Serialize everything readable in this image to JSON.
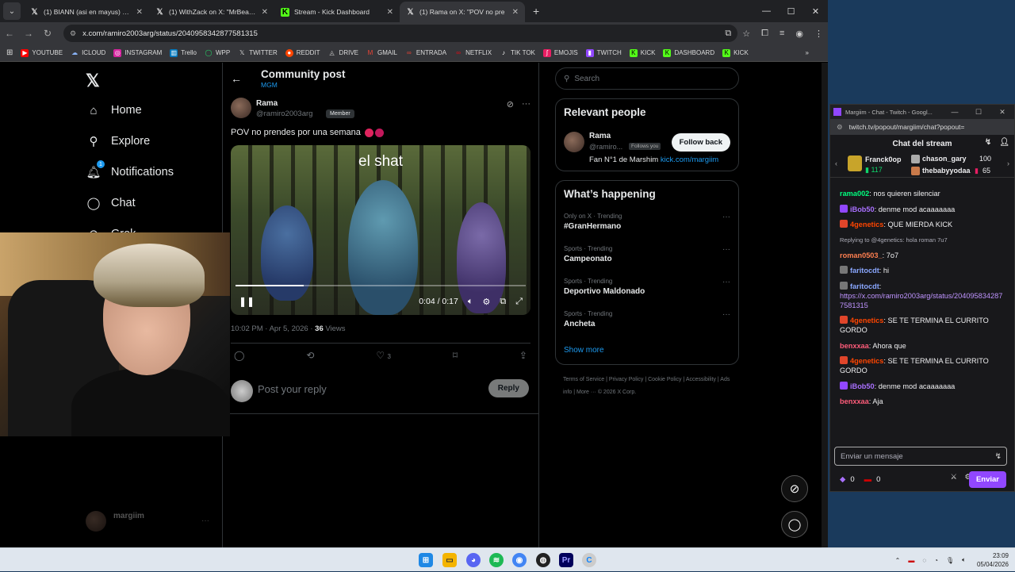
{
  "browser": {
    "tabs": [
      {
        "title": "(1) BIANN (asi en mayus) on X:",
        "icon": "x-icon"
      },
      {
        "title": "(1) WithZack on X: \"MrBeast ha",
        "icon": "x-icon"
      },
      {
        "title": "Stream - Kick Dashboard",
        "icon": "kick-icon"
      },
      {
        "title": "(1) Rama on X: \"POV no pre",
        "icon": "x-icon"
      }
    ],
    "url": "x.com/ramiro2003arg/status/2040958342877581315",
    "bookmarks": [
      "YOUTUBE",
      "ICLOUD",
      "INSTAGRAM",
      "Trello",
      "WPP",
      "TWITTER",
      "REDDIT",
      "DRIVE",
      "GMAIL",
      "ENTRADA",
      "NETFLIX",
      "TIK TOK",
      "EMOJIS",
      "TWITCH",
      "KICK",
      "DASHBOARD",
      "KICK"
    ]
  },
  "x": {
    "nav": {
      "home": "Home",
      "explore": "Explore",
      "notifications": "Notifications",
      "notif_count": "1",
      "chat": "Chat",
      "grok": "Grok"
    },
    "header": {
      "title": "Community post",
      "community": "MGM"
    },
    "post": {
      "name": "Rama",
      "handle": "@ramiro2003arg",
      "member_badge": "Member",
      "text": "POV no prendes por una semana",
      "video_caption": "el shat",
      "video_time": "0:04 / 0:17",
      "video_progress": 0.235,
      "meta_time": "10:02 PM · Apr 5, 2026 · ",
      "views_count": "36",
      "views_label": " Views",
      "likes": "3"
    },
    "reply": {
      "placeholder": "Post your reply",
      "button": "Reply"
    },
    "search_placeholder": "Search",
    "relevant": {
      "title": "Relevant people",
      "name": "Rama",
      "handle": "@ramiro...",
      "follows_you": "Follows you",
      "follow_button": "Follow back",
      "bio": "Fan N°1 de Marshim ",
      "bio_link": "kick.com/margiim"
    },
    "happening": {
      "title": "What’s happening",
      "trends": [
        {
          "context": "Only on X · Trending",
          "name": "#GranHermano"
        },
        {
          "context": "Sports · Trending",
          "name": "Campeonato"
        },
        {
          "context": "Sports · Trending",
          "name": "Deportivo Maldonado"
        },
        {
          "context": "Sports · Trending",
          "name": "Ancheta"
        }
      ],
      "show_more": "Show more"
    },
    "footer": "Terms of Service  |  Privacy Policy  |  Cookie Policy  |  Accessibility  |  Ads info  |  More ···  © 2026 X Corp.",
    "ghost_user": "margiim"
  },
  "twitch": {
    "window_title": "Margiim - Chat - Twitch - Googl...",
    "url": "twitch.tv/popout/margiim/chat?popout=",
    "header": "Chat del stream",
    "gifts": [
      {
        "user": "Franck0op",
        "count": "117"
      },
      {
        "user": "chason_gary",
        "count": "100"
      },
      {
        "user": "thebabyyodaa",
        "count": "65"
      }
    ],
    "messages": [
      {
        "user": "rama002",
        "color": "#00ff7f",
        "text": ": nos quieren silenciar",
        "badge": ""
      },
      {
        "user": "iBob50",
        "color": "#a970ff",
        "text": ": denme mod acaaaaaaa",
        "badge": "#9147ff"
      },
      {
        "user": "4genetics",
        "color": "#ff4500",
        "text": ": QUE MIERDA KICK",
        "badge": "#e0452a"
      },
      {
        "reply_note": "Replying to @4genetics: hola roman 7u7"
      },
      {
        "user": "roman0503_",
        "color": "#ff7f50",
        "text": ": 7o7",
        "badge": ""
      },
      {
        "user": "faritocdt",
        "color": "#8aa7ff",
        "text": ": hi",
        "badge": "#777"
      },
      {
        "user": "faritocdt",
        "color": "#8aa7ff",
        "text": ":",
        "badge": "#777",
        "link": "https://x.com/ramiro2003arg/status/2040958342877581315"
      },
      {
        "user": "4genetics",
        "color": "#ff4500",
        "text": ": SE TE TERMINA EL CURRITO GORDO",
        "badge": "#e0452a"
      },
      {
        "user": "benxxaa",
        "color": "#ff5c7a",
        "text": ": Ahora que",
        "badge": ""
      },
      {
        "user": "4genetics",
        "color": "#ff4500",
        "text": ": SE TE TERMINA EL CURRITO GORDO",
        "badge": "#e0452a"
      },
      {
        "user": "iBob50",
        "color": "#a970ff",
        "text": ": denme mod acaaaaaaa",
        "badge": "#9147ff"
      },
      {
        "user": "benxxaa",
        "color": "#ff5c7a",
        "text": ": Aja",
        "badge": ""
      }
    ],
    "input_placeholder": "Enviar un mensaje",
    "points": "0",
    "bits": "0",
    "send": "Enviar"
  },
  "taskbar": {
    "time": "23:09",
    "date": "05/04/2026"
  }
}
